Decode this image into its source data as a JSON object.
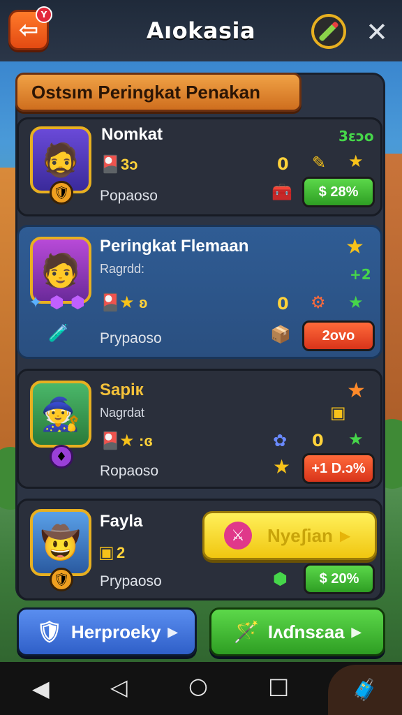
{
  "app": {
    "title": "Aıokasia",
    "back_badge": "Y"
  },
  "section": {
    "title": "Ostsım Peringkat Penakan"
  },
  "cards": [
    {
      "name": "Nomkat",
      "top_right": "3ɛɔo",
      "stat": "3ɔ",
      "zero": "0",
      "bottom_label": "Popaoso",
      "pill": "$ 28%"
    },
    {
      "name": "Peringkat Flemaan",
      "sub": "Ragrdd:",
      "top_right": "+2",
      "stat": "ʚ",
      "zero": "0",
      "bottom_label": "Prypaoso",
      "pill": "2ovo"
    },
    {
      "name": "Sapiк",
      "sub": "Naɡrdat",
      "stat": ":ɞ",
      "zero": "0",
      "bottom_label": "Ropaoso",
      "pill": "+1 D.ɔ%"
    },
    {
      "name": "Fayla",
      "stat": "2",
      "bottom_label": "Prypaoso",
      "pill": "$ 20%",
      "action_label": "Nyeʃian"
    }
  ],
  "buttons": {
    "left_label": "Herproeky",
    "right_label": "Iʌɗnsɛaa"
  },
  "colors": {
    "accent_orange": "#e34a12",
    "gold": "#f7c21a",
    "green": "#2e9e23",
    "red": "#d8341a",
    "blue": "#2f5fc8"
  }
}
